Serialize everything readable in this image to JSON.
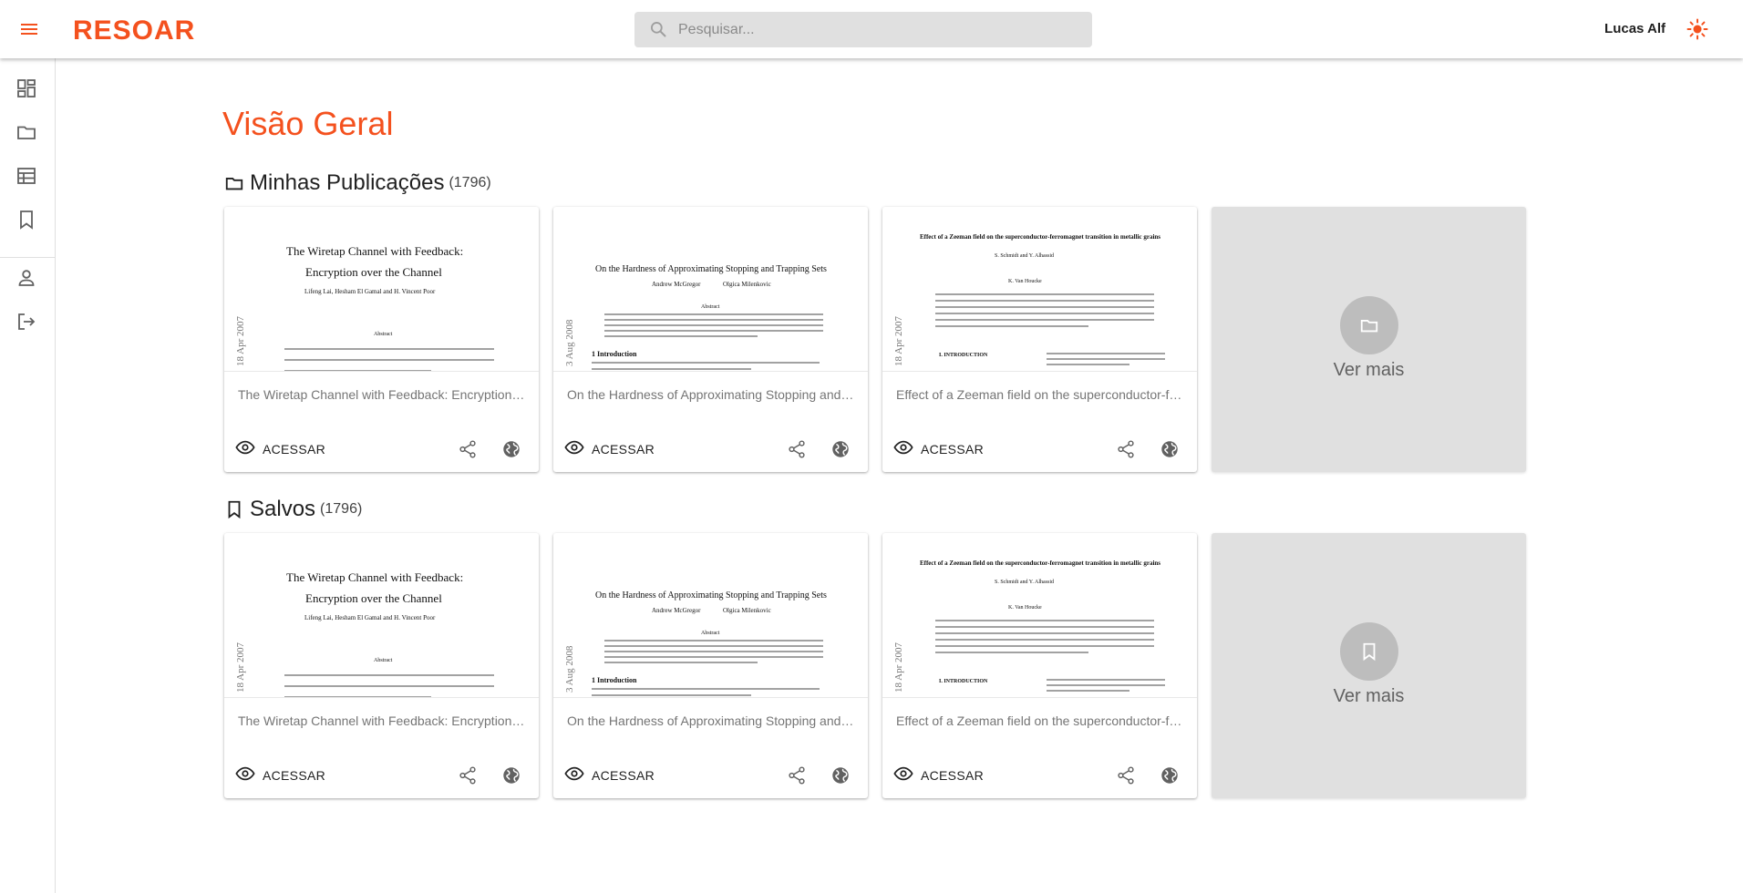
{
  "app": {
    "logo": "RESOAR",
    "accent_color": "#f4511e"
  },
  "header": {
    "search_placeholder": "Pesquisar...",
    "user_name": "Lucas Alf"
  },
  "sidebar": {
    "items": [
      {
        "icon": "dashboard-icon"
      },
      {
        "icon": "folder-icon"
      },
      {
        "icon": "table-icon"
      },
      {
        "icon": "bookmark-icon"
      },
      {
        "icon": "person-icon"
      },
      {
        "icon": "logout-icon"
      }
    ]
  },
  "main": {
    "title": "Visão Geral",
    "sections": [
      {
        "title": "Minhas Publicações",
        "count": "(1796)",
        "icon": "folder-icon",
        "cards": [
          {
            "title": "The Wiretap Channel with Feedback: Encryption over the Channel",
            "action": "ACESSAR"
          },
          {
            "title": "On the Hardness of Approximating Stopping and Trapping Sets",
            "action": "ACESSAR"
          },
          {
            "title": "Effect of a Zeeman field on the superconductor-ferromagnet transition in metallic grains",
            "action": "ACESSAR"
          }
        ],
        "more_label": "Ver mais"
      },
      {
        "title": "Salvos",
        "count": "(1796)",
        "icon": "bookmark-icon",
        "cards": [
          {
            "title": "The Wiretap Channel with Feedback: Encryption over the Channel",
            "action": "ACESSAR"
          },
          {
            "title": "On the Hardness of Approximating Stopping and Trapping Sets",
            "action": "ACESSAR"
          },
          {
            "title": "Effect of a Zeeman field on the superconductor-ferromagnet transition in metallic grains",
            "action": "ACESSAR"
          }
        ],
        "more_label": "Ver mais"
      }
    ]
  },
  "thumbnails": {
    "wiretap": {
      "title_1": "The Wiretap Channel with Feedback:",
      "title_2": "Encryption over the Channel",
      "authors": "Lifeng Lai, Hesham El Gamal and H. Vincent Poor",
      "abstract_head": "Abstract",
      "stamp": "18 Apr 2007"
    },
    "hardness": {
      "title": "On the Hardness of Approximating Stopping and Trapping Sets",
      "authors": "Andrew McGregor",
      "authors_2": "Olgica Milenkovic",
      "abstract_head": "Abstract",
      "section": "1   Introduction",
      "stamp": "3 Aug 2008"
    },
    "zeeman": {
      "title": "Effect of a Zeeman field on the superconductor-ferromagnet transition in metallic grains",
      "authors": "S. Schmidt and Y. Alhassid",
      "authors_2": "K. Van Houcke",
      "section": "I.   INTRODUCTION",
      "stamp": "18 Apr 2007"
    }
  }
}
